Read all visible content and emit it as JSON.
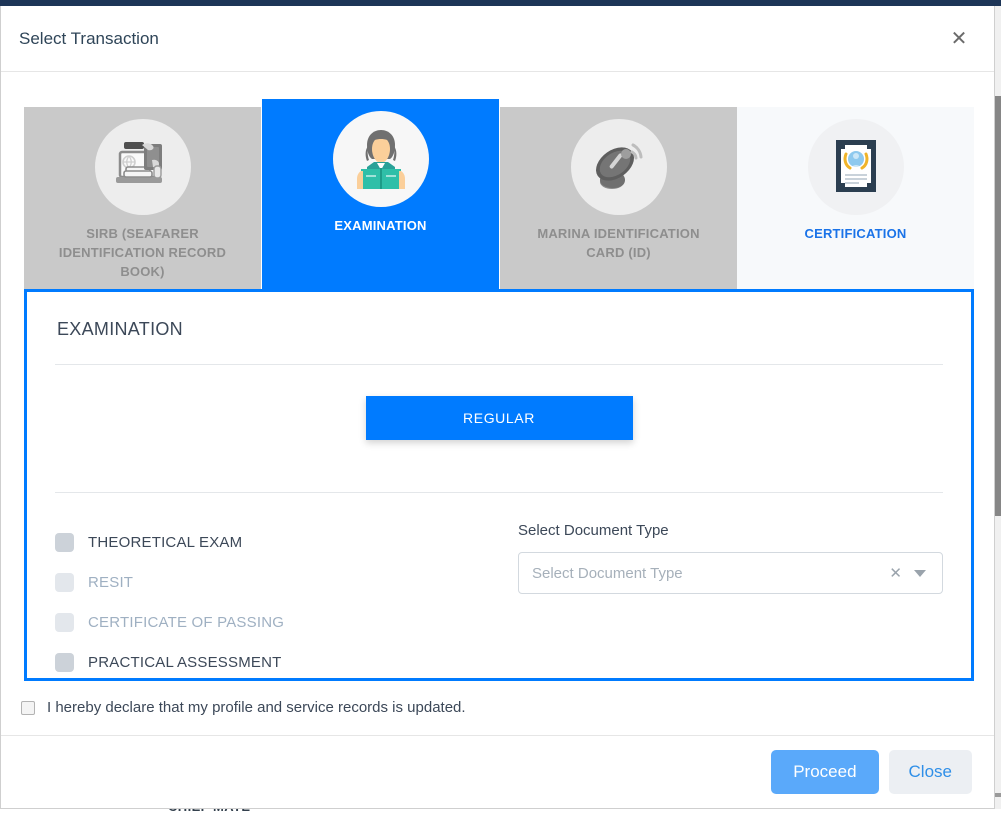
{
  "background": {
    "obscured_text": "CHIEF MATE"
  },
  "modal": {
    "title": "Select Transaction",
    "close_icon": "close-icon"
  },
  "tabs": [
    {
      "id": "sirb",
      "label": "SIRB (SEAFARER IDENTIFICATION RECORD BOOK)",
      "icon": "record-book-laptop-icon",
      "state": "inactive"
    },
    {
      "id": "examination",
      "label": "EXAMINATION",
      "icon": "student-reading-book-icon",
      "state": "active"
    },
    {
      "id": "marina-id",
      "label": "MARINA IDENTIFICATION CARD (ID)",
      "icon": "satellite-dish-icon",
      "state": "inactive"
    },
    {
      "id": "certification",
      "label": "CERTIFICATION",
      "icon": "certificate-icon",
      "state": "available"
    }
  ],
  "panel": {
    "heading": "EXAMINATION",
    "regular_button": "REGULAR",
    "checkboxes": [
      {
        "label": "THEORETICAL EXAM",
        "checked": false,
        "disabled": false
      },
      {
        "label": "RESIT",
        "checked": false,
        "disabled": true
      },
      {
        "label": "CERTIFICATE OF PASSING",
        "checked": false,
        "disabled": true
      },
      {
        "label": "PRACTICAL ASSESSMENT",
        "checked": false,
        "disabled": false
      }
    ],
    "document_type": {
      "label": "Select Document Type",
      "placeholder": "Select Document Type",
      "value": "",
      "clear_icon": "clear-x-icon",
      "caret_icon": "chevron-down-icon"
    }
  },
  "declaration": {
    "text": "I hereby declare that my profile and service records is updated.",
    "checked": false
  },
  "footer": {
    "proceed_label": "Proceed",
    "close_label": "Close"
  },
  "colors": {
    "accent_blue": "#007bff",
    "proceed_blue": "#5aa9fa",
    "link_blue": "#1a73e8",
    "tab_inactive_gray": "#c9c9c9",
    "text_dark": "#3c4858",
    "disabled_text": "#9fb0c2"
  }
}
